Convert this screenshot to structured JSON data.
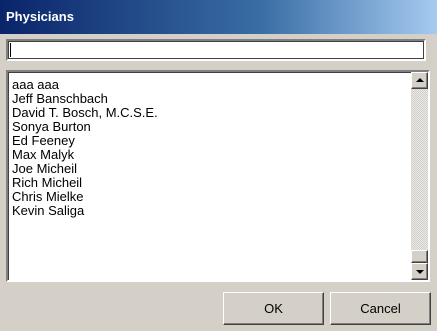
{
  "window": {
    "title": "Physicians"
  },
  "search": {
    "value": ""
  },
  "physicians": {
    "items": [
      "aaa aaa",
      "Jeff Banschbach",
      "David T. Bosch, M.C.S.E.",
      "Sonya Burton",
      "Ed Feeney",
      "Max Malyk",
      "Joe Micheil",
      "Rich Micheil",
      "Chris Mielke",
      "Kevin Saliga"
    ]
  },
  "buttons": {
    "ok_label": "OK",
    "cancel_label": "Cancel"
  },
  "colors": {
    "title_bar_start": "#0a246a",
    "title_bar_end": "#a6caf0",
    "dialog_background": "#d4d0c8"
  },
  "icons": {
    "scroll_up": "triangle-up",
    "scroll_down": "triangle-down"
  }
}
